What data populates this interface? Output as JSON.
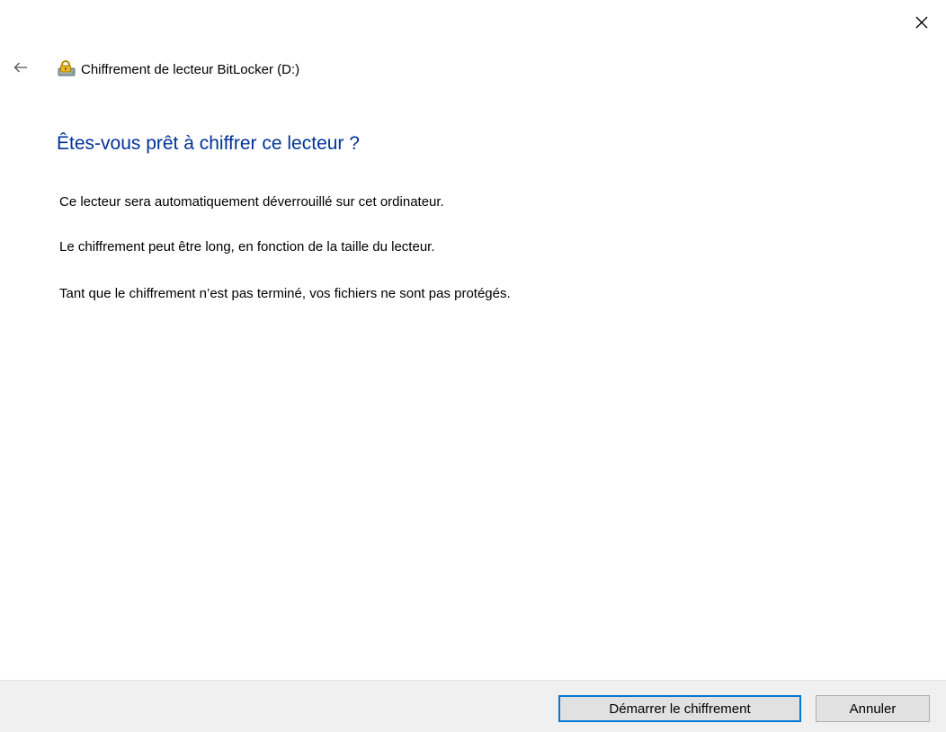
{
  "window": {
    "title": "Chiffrement de lecteur BitLocker (D:)"
  },
  "icons": {
    "close": "close-icon",
    "back": "back-arrow-icon",
    "app": "bitlocker-drive-icon"
  },
  "main": {
    "heading": "Êtes-vous prêt à chiffrer ce lecteur ?",
    "paragraphs": [
      "Ce lecteur sera automatiquement déverrouillé sur cet ordinateur.",
      "Le chiffrement peut être long, en fonction de la taille du lecteur.",
      "Tant que le chiffrement n’est pas terminé, vos fichiers ne sont pas protégés."
    ]
  },
  "footer": {
    "start_label": "Démarrer le chiffrement",
    "cancel_label": "Annuler"
  },
  "colors": {
    "heading": "#003399",
    "footer_bg": "#f0f0f0",
    "default_button_border": "#0078d7"
  }
}
